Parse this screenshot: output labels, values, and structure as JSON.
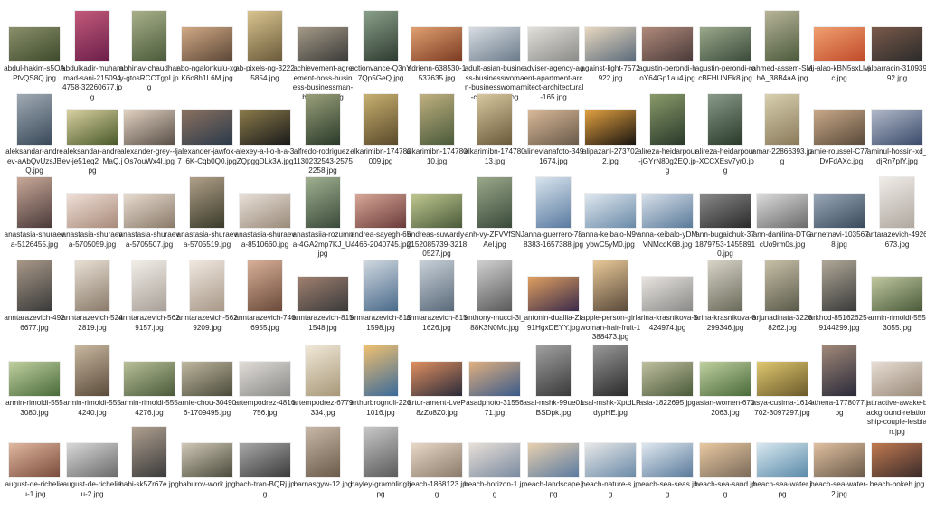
{
  "files": [
    [
      {
        "name": "abdul-hakim-s5OAPfvQS8Q.jpg",
        "orient": "l",
        "c1": "#3d4a2c",
        "c2": "#8a8f6a"
      },
      {
        "name": "abdulkadir-muhammad-sani-2150944758-32260677.jpg",
        "orient": "p",
        "c1": "#6b1e4a",
        "c2": "#c25a7a"
      },
      {
        "name": "abhinav-chaudhary-gtosRCCTgpI.jpg",
        "orient": "p",
        "c1": "#4a5a3a",
        "c2": "#a8b08a"
      },
      {
        "name": "abo-ngalonkulu-xgK6o8h1L6M.jpg",
        "orient": "l",
        "c1": "#5a4636",
        "c2": "#d2a985"
      },
      {
        "name": "ab-pixels-ng-32225854.jpg",
        "orient": "p",
        "c1": "#6a5a3a",
        "c2": "#d9c48f"
      },
      {
        "name": "achievement-agreement-boss-business-businessman-business.jpg",
        "orient": "l",
        "c1": "#3a3a38",
        "c2": "#a59a88"
      },
      {
        "name": "actionvance-Q3nY7Qp5GeQ.jpg",
        "orient": "p",
        "c1": "#2e3a30",
        "c2": "#8aa08a"
      },
      {
        "name": "adrienn-638530-1537635.jpg",
        "orient": "l",
        "c1": "#7a3a22",
        "c2": "#e0a070"
      },
      {
        "name": "adult-asian-business-businesswoman-businesswoman-caucasian.jpg",
        "orient": "l",
        "c1": "#6a7a8a",
        "c2": "#d8dde2"
      },
      {
        "name": "adviser-agency-agent-apartment-architect-architectural-165.jpg",
        "orient": "l",
        "c1": "#8a8a88",
        "c2": "#e2e0da"
      },
      {
        "name": "against-light-7572922.jpg",
        "orient": "l",
        "c1": "#5a6a7a",
        "c2": "#e8d8c0"
      },
      {
        "name": "agustin-perondi-hoY64Gp1au4.jpg",
        "orient": "l",
        "c1": "#4a3a3a",
        "c2": "#b08a7a"
      },
      {
        "name": "agustin-perondi-rocBFHUNEk8.jpg",
        "orient": "l",
        "c1": "#3a4a3a",
        "c2": "#9aa88a"
      },
      {
        "name": "ahmed-assem-SMhA_38B4aA.jpg",
        "orient": "p",
        "c1": "#4a5a3a",
        "c2": "#b8b49a"
      },
      {
        "name": "aj-alao-kBN5sxLlvjc.jpg",
        "orient": "l",
        "c1": "#c04a2a",
        "c2": "#f0a070"
      },
      {
        "name": "albarracin-31093992.jpg",
        "orient": "l",
        "c1": "#2a2a2a",
        "c2": "#7a5a4a"
      }
    ],
    [
      {
        "name": "aleksandar-andreev-aAbQvUzsJBQ.jpg",
        "orient": "p",
        "c1": "#3a4a5a",
        "c2": "#a0aab4"
      },
      {
        "name": "aleksandar-andreev-je51eq2_MaQ.jpg",
        "orient": "l",
        "c1": "#4a5a2a",
        "c2": "#d8cfa0"
      },
      {
        "name": "alexander-grey--ljOs7ouWx4I.jpg",
        "orient": "l",
        "c1": "#5a5048",
        "c2": "#e0d0c0"
      },
      {
        "name": "alexander-jawfox-7_6K-Cqb0Q0.jpg",
        "orient": "l",
        "c1": "#2a3a4a",
        "c2": "#8a7060"
      },
      {
        "name": "alexey-a-l-o-h-a-3ZQpggDLk3A.jpg",
        "orient": "l",
        "c1": "#1a1a1a",
        "c2": "#8a7a4a"
      },
      {
        "name": "alfredo-rodriguez-1130232543-25752258.jpg",
        "orient": "p",
        "c1": "#2a3a2a",
        "c2": "#9aa07a"
      },
      {
        "name": "alkarimibn-174780009.jpg",
        "orient": "p",
        "c1": "#5a4a2a",
        "c2": "#c8b070"
      },
      {
        "name": "alkarimibn-17478010.jpg",
        "orient": "p",
        "c1": "#4a5a3a",
        "c2": "#c0b080"
      },
      {
        "name": "alkarimibn-17478013.jpg",
        "orient": "p",
        "c1": "#6a5a3a",
        "c2": "#d8c8a0"
      },
      {
        "name": "alinevianafoto-3491674.jpg",
        "orient": "l",
        "c1": "#6a5a4a",
        "c2": "#d8b898"
      },
      {
        "name": "alipazani-2737022.jpg",
        "orient": "l",
        "c1": "#1a1410",
        "c2": "#e0a040"
      },
      {
        "name": "alireza-heidarpour-jGYrN80g2EQ.jpg",
        "orient": "p",
        "c1": "#2a3a2a",
        "c2": "#8a9a6a"
      },
      {
        "name": "alireza-heidarpour-XCCXEsv7yr0.jpg",
        "orient": "p",
        "c1": "#2a3a2a",
        "c2": "#8a9a8a"
      },
      {
        "name": "amar-22866393.jpg",
        "orient": "p",
        "c1": "#8a7a5a",
        "c2": "#d8d0b0"
      },
      {
        "name": "amie-roussel-C77_DvFdAXc.jpg",
        "orient": "l",
        "c1": "#5a4a3a",
        "c2": "#c8a888"
      },
      {
        "name": "aminul-hossin-xd_djRn7pIY.jpg",
        "orient": "l",
        "c1": "#3a4a6a",
        "c2": "#b0b8c8"
      }
    ],
    [
      {
        "name": "anastasia-shuraeva-5126455.jpg",
        "orient": "p",
        "c1": "#4a3a3a",
        "c2": "#c8a898"
      },
      {
        "name": "anastasia-shuraeva-5705059.jpg",
        "orient": "l",
        "c1": "#a88a7a",
        "c2": "#f0e0d8"
      },
      {
        "name": "anastasia-shuraeva-5705507.jpg",
        "orient": "l",
        "c1": "#8a7a6a",
        "c2": "#e8dcd0"
      },
      {
        "name": "anastasia-shuraeva-5705519.jpg",
        "orient": "p",
        "c1": "#3a3a2a",
        "c2": "#b0a088"
      },
      {
        "name": "anastasia-shuraeva-8510660.jpg",
        "orient": "l",
        "c1": "#9a8a7a",
        "c2": "#e8e0d8"
      },
      {
        "name": "anastasiia-rozumna-4GA2mp7KJ_U.jpg",
        "orient": "p",
        "c1": "#3a4a3a",
        "c2": "#a0b090"
      },
      {
        "name": "andrea-sayegh-654466-2040745.jpg",
        "orient": "l",
        "c1": "#6a3a3a",
        "c2": "#d8a898"
      },
      {
        "name": "andreas-suwardy-2152085739-32180527.jpg",
        "orient": "l",
        "c1": "#4a5a3a",
        "c2": "#c0c890"
      },
      {
        "name": "anh-vy-ZFVVfSNJAeI.jpg",
        "orient": "p",
        "c1": "#3a4a3a",
        "c2": "#9aa88a"
      },
      {
        "name": "anna-guerrero-788383-1657388.jpg",
        "orient": "p",
        "c1": "#5a7aa0",
        "c2": "#d8e4ee"
      },
      {
        "name": "anna-keibalo-N9vybwC5yM0.jpg",
        "orient": "l",
        "c1": "#6a8aa8",
        "c2": "#e0e8f0"
      },
      {
        "name": "anna-keibalo-yDMVNMcdK68.jpg",
        "orient": "l",
        "c1": "#5a7a9a",
        "c2": "#d8e0ea"
      },
      {
        "name": "ann-bugaichuk-371879753-14558910.jpg",
        "orient": "l",
        "c1": "#2a2a2a",
        "c2": "#8a8a8a"
      },
      {
        "name": "ann-danilina-DTGcUo9rm0s.jpg",
        "orient": "l",
        "c1": "#6a6a6a",
        "c2": "#dcdcdc"
      },
      {
        "name": "annetnavi-1035678.jpg",
        "orient": "l",
        "c1": "#3a4a5a",
        "c2": "#9aa8b8"
      },
      {
        "name": "antarazevich-4926673.jpg",
        "orient": "p",
        "c1": "#b0a8a0",
        "c2": "#f0ece8"
      }
    ],
    [
      {
        "name": "anntarazevich-4926677.jpg",
        "orient": "p",
        "c1": "#3a3a3a",
        "c2": "#a89888"
      },
      {
        "name": "anntarazevich-5242819.jpg",
        "orient": "p",
        "c1": "#8a7a6a",
        "c2": "#e8e0d4"
      },
      {
        "name": "anntarazevich-5629157.jpg",
        "orient": "p",
        "c1": "#a8a098",
        "c2": "#f2eee8"
      },
      {
        "name": "anntarazevich-5629209.jpg",
        "orient": "p",
        "c1": "#a89888",
        "c2": "#f0e8e0"
      },
      {
        "name": "anntarazevich-7466955.jpg",
        "orient": "p",
        "c1": "#6a4a3a",
        "c2": "#d8b098"
      },
      {
        "name": "anntarazevich-8151548.jpg",
        "orient": "l",
        "c1": "#3a3a3a",
        "c2": "#a08070"
      },
      {
        "name": "anntarazevich-8151598.jpg",
        "orient": "p",
        "c1": "#4a6a8a",
        "c2": "#d0d8e0"
      },
      {
        "name": "anntarazevich-8151626.jpg",
        "orient": "p",
        "c1": "#5a6a7a",
        "c2": "#c8d0d8"
      },
      {
        "name": "anthony-mucci-3i_88K3N0Mc.jpg",
        "orient": "p",
        "c1": "#5a5a5a",
        "c2": "#d0d0d0"
      },
      {
        "name": "antonin-duallia-Zk91HgxDEYY.jpg",
        "orient": "l",
        "c1": "#3a2a4a",
        "c2": "#e0a060"
      },
      {
        "name": "apple-person-girl-woman-hair-fruit-1388473.jpg",
        "orient": "p",
        "c1": "#5a4a3a",
        "c2": "#e8c898"
      },
      {
        "name": "arina-krasnikova-5424974.jpg",
        "orient": "l",
        "c1": "#8a8a88",
        "c2": "#e8e4e0"
      },
      {
        "name": "arina-krasnikova-6299346.jpg",
        "orient": "p",
        "c1": "#6a6a5a",
        "c2": "#d8d4c8"
      },
      {
        "name": "arjunadinata-32268262.jpg",
        "orient": "p",
        "c1": "#5a5a4a",
        "c2": "#c8c0a8"
      },
      {
        "name": "arkhod-85162625-9144299.jpg",
        "orient": "p",
        "c1": "#3a3a3a",
        "c2": "#b0a898"
      },
      {
        "name": "armin-rimoldi-5553055.jpg",
        "orient": "l",
        "c1": "#4a5a3a",
        "c2": "#c0c8a0"
      }
    ],
    [
      {
        "name": "armin-rimoldi-5553080.jpg",
        "orient": "l",
        "c1": "#4a6a3a",
        "c2": "#c0d0a0"
      },
      {
        "name": "armin-rimoldi-5554240.jpg",
        "orient": "p",
        "c1": "#5a4a3a",
        "c2": "#c8b8a0"
      },
      {
        "name": "armin-rimoldi-5554276.jpg",
        "orient": "l",
        "c1": "#4a5a3a",
        "c2": "#b8c098"
      },
      {
        "name": "arnie-chou-304906-1709495.jpg",
        "orient": "l",
        "c1": "#4a4a3a",
        "c2": "#c0b8a0"
      },
      {
        "name": "artempodrez-4816756.jpg",
        "orient": "l",
        "c1": "#8a8a88",
        "c2": "#e0dcd8"
      },
      {
        "name": "artempodrez-6779334.jpg",
        "orient": "p",
        "c1": "#a89878",
        "c2": "#f0e8d8"
      },
      {
        "name": "arthurbrognoli-2261016.jpg",
        "orient": "p",
        "c1": "#3a6a9a",
        "c2": "#f0c070"
      },
      {
        "name": "artur-ament-LveP8zZo8Z0.jpg",
        "orient": "l",
        "c1": "#2a2a3a",
        "c2": "#e09060"
      },
      {
        "name": "asadphoto-3155671.jpg",
        "orient": "l",
        "c1": "#3a5a8a",
        "c2": "#e0b080"
      },
      {
        "name": "asal-mshk-99ue01BSDpk.jpg",
        "orient": "p",
        "c1": "#3a3a3a",
        "c2": "#a0a0a0"
      },
      {
        "name": "asal-mshk-XptdLPdypHE.jpg",
        "orient": "p",
        "c1": "#2a2a2a",
        "c2": "#989898"
      },
      {
        "name": "asia-1822695.jpg",
        "orient": "l",
        "c1": "#4a5a3a",
        "c2": "#c0c0a0"
      },
      {
        "name": "asian-women-6702063.jpg",
        "orient": "l",
        "c1": "#4a6a3a",
        "c2": "#c0d0a0"
      },
      {
        "name": "asya-cusima-1614702-3097297.jpg",
        "orient": "l",
        "c1": "#6a5a2a",
        "c2": "#e0c870"
      },
      {
        "name": "athena-1778077.jpg",
        "orient": "p",
        "c1": "#2a2a3a",
        "c2": "#a08878"
      },
      {
        "name": "attractive-awake-background-relationship-couple-lesbian.jpg",
        "orient": "l",
        "c1": "#9a8a7a",
        "c2": "#e8ded4"
      }
    ],
    [
      {
        "name": "august-de-richelieu-1.jpg",
        "orient": "l",
        "c1": "#7a4a3a",
        "c2": "#e0b8a0"
      },
      {
        "name": "august-de-richelieu-2.jpg",
        "orient": "l",
        "c1": "#6a6a6a",
        "c2": "#d8d8d8"
      },
      {
        "name": "babi-sk5Zr67e.jpg",
        "orient": "p",
        "c1": "#3a3a3a",
        "c2": "#b0a090"
      },
      {
        "name": "baburov-work.jpg",
        "orient": "l",
        "c1": "#4a4a3a",
        "c2": "#d0c8b8"
      },
      {
        "name": "bach-tran-BQRj.jpg",
        "orient": "l",
        "c1": "#3a3a3a",
        "c2": "#a8a8a8"
      },
      {
        "name": "barnasgyw-12.jpg",
        "orient": "p",
        "c1": "#6a5a4a",
        "c2": "#c8b8a8"
      },
      {
        "name": "bayley-grambling.jpg",
        "orient": "p",
        "c1": "#5a5a5a",
        "c2": "#c8c8c8"
      },
      {
        "name": "beach-1868123.jpg",
        "orient": "l",
        "c1": "#8a7a6a",
        "c2": "#e8d8c8"
      },
      {
        "name": "beach-horizon-1.jpg",
        "orient": "l",
        "c1": "#7a8aa0",
        "c2": "#e8e0d8"
      },
      {
        "name": "beach-landscape.jpg",
        "orient": "l",
        "c1": "#5a7aa0",
        "c2": "#e8d0b0"
      },
      {
        "name": "beach-nature-s.jpg",
        "orient": "l",
        "c1": "#6a8aa8",
        "c2": "#e8e8e8"
      },
      {
        "name": "beach-sea-seas.jpg",
        "orient": "l",
        "c1": "#5a7a9a",
        "c2": "#e0e8f0"
      },
      {
        "name": "beach-sea-sand.jpg",
        "orient": "l",
        "c1": "#7a6a5a",
        "c2": "#e8c8a0"
      },
      {
        "name": "beach-sea-water.jpg",
        "orient": "l",
        "c1": "#5a8aa8",
        "c2": "#d8e8f0"
      },
      {
        "name": "beach-sea-water-2.jpg",
        "orient": "l",
        "c1": "#6a5a4a",
        "c2": "#e0c0a0"
      },
      {
        "name": "beach-bokeh.jpg",
        "orient": "l",
        "c1": "#3a2a2a",
        "c2": "#c07a50"
      }
    ]
  ]
}
